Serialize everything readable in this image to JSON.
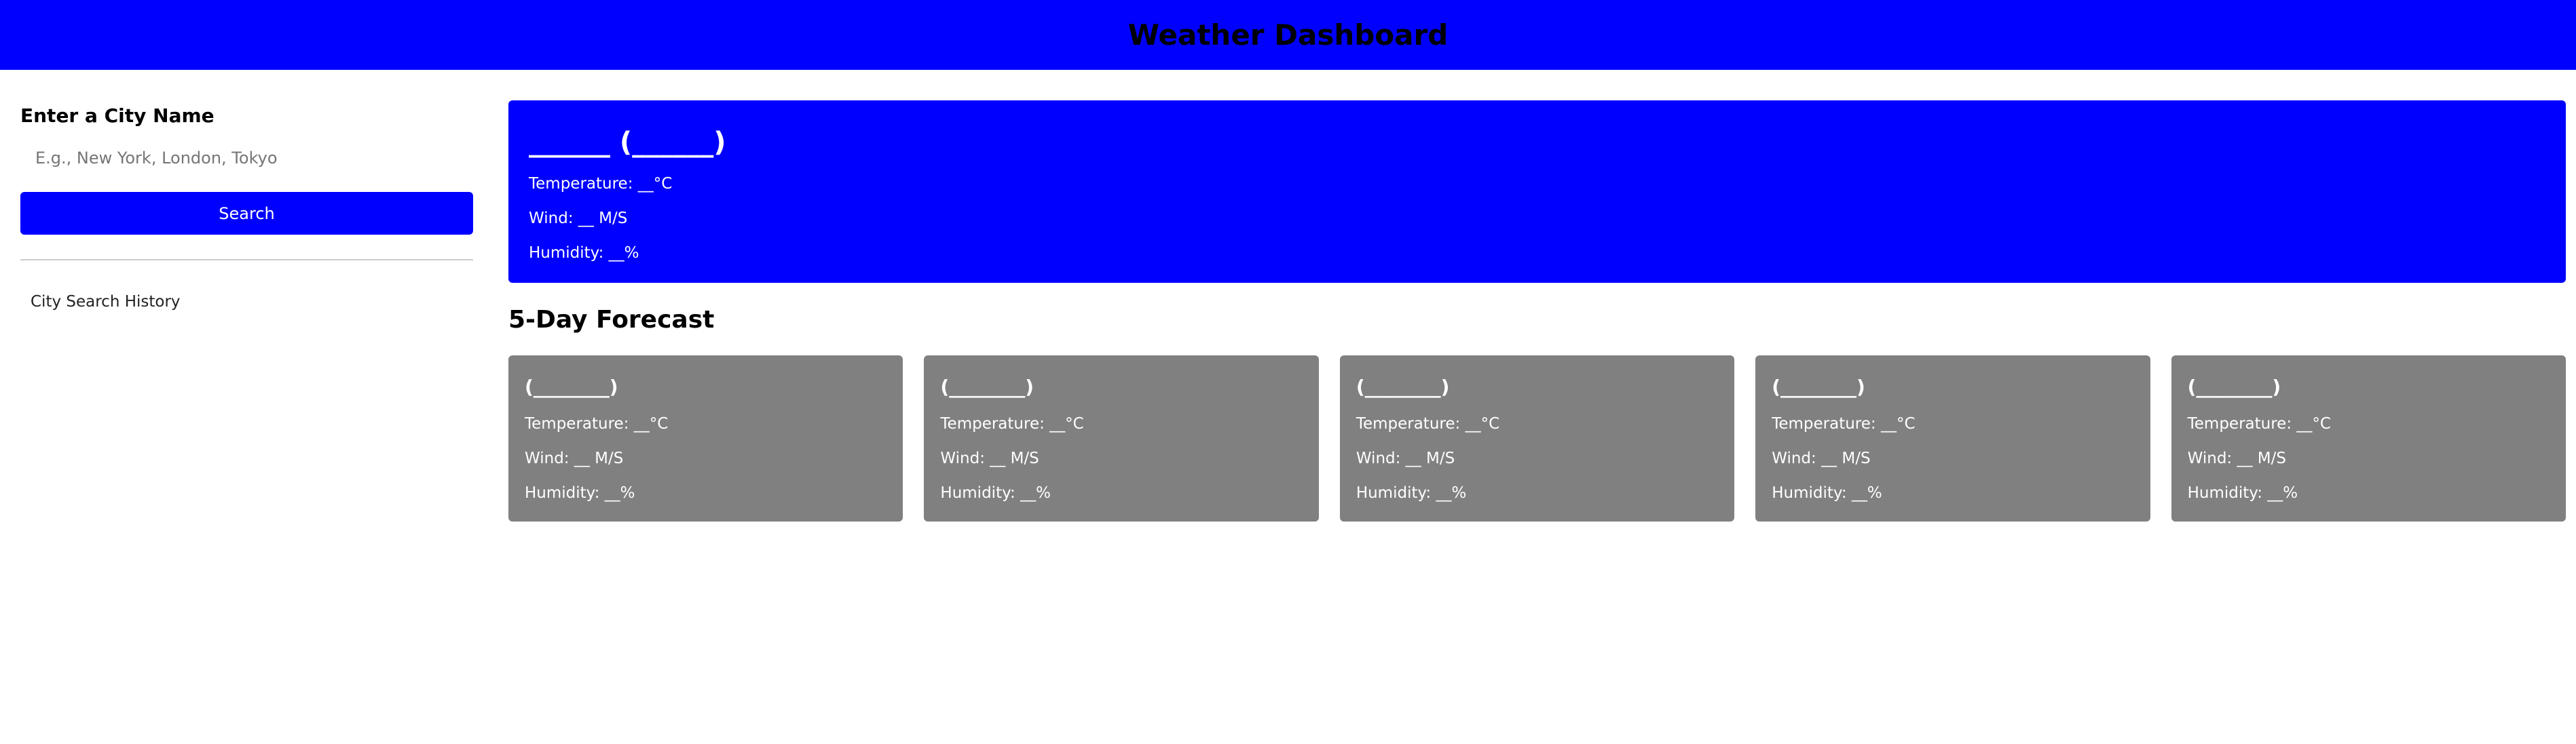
{
  "header": {
    "title": "Weather Dashboard"
  },
  "colors": {
    "header_bg": "#0000ff",
    "current_card_bg": "#0000ff",
    "forecast_card_bg": "#808080",
    "button_bg": "#0000ff"
  },
  "sidebar": {
    "title": "Enter a City Name",
    "search_placeholder": "E.g., New York, London, Tokyo",
    "search_value": "",
    "search_button_label": "Search",
    "history_label": "City Search History"
  },
  "current": {
    "city_title": "______ (______)",
    "temperature": "Temperature: __°C",
    "wind": "Wind: __ M/S",
    "humidity": "Humidity: __%"
  },
  "forecast": {
    "heading": "5-Day Forecast",
    "days": [
      {
        "date": "(________)",
        "temperature": "Temperature: __°C",
        "wind": "Wind: __ M/S",
        "humidity": "Humidity: __%"
      },
      {
        "date": "(________)",
        "temperature": "Temperature: __°C",
        "wind": "Wind: __ M/S",
        "humidity": "Humidity: __%"
      },
      {
        "date": "(________)",
        "temperature": "Temperature: __°C",
        "wind": "Wind: __ M/S",
        "humidity": "Humidity: __%"
      },
      {
        "date": "(________)",
        "temperature": "Temperature: __°C",
        "wind": "Wind: __ M/S",
        "humidity": "Humidity: __%"
      },
      {
        "date": "(________)",
        "temperature": "Temperature: __°C",
        "wind": "Wind: __ M/S",
        "humidity": "Humidity: __%"
      }
    ]
  }
}
